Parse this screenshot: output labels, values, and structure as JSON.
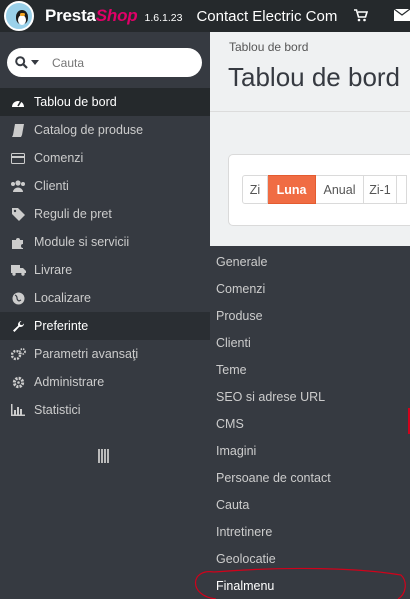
{
  "header": {
    "brand_main": "Presta",
    "brand_shop": "Shop",
    "version": "1.6.1.23",
    "shop_name": "Contact Electric Com",
    "icons": [
      "cart-icon",
      "envelope-icon"
    ]
  },
  "search": {
    "placeholder": "Cauta"
  },
  "sidebar": {
    "items": [
      {
        "label": "Tablou de bord",
        "icon": "dashboard-icon",
        "state": "active"
      },
      {
        "label": "Catalog de produse",
        "icon": "book-icon"
      },
      {
        "label": "Comenzi",
        "icon": "credit-card-icon"
      },
      {
        "label": "Clienti",
        "icon": "users-icon"
      },
      {
        "label": "Reguli de pret",
        "icon": "tag-icon"
      },
      {
        "label": "Module si servicii",
        "icon": "puzzle-icon"
      },
      {
        "label": "Livrare",
        "icon": "truck-icon"
      },
      {
        "label": "Localizare",
        "icon": "globe-icon"
      },
      {
        "label": "Preferinte",
        "icon": "wrench-icon",
        "state": "hover"
      },
      {
        "label": "Parametri avansaţi",
        "icon": "cogs-icon"
      },
      {
        "label": "Administrare",
        "icon": "gear-icon"
      },
      {
        "label": "Statistici",
        "icon": "bar-chart-icon"
      }
    ]
  },
  "content": {
    "breadcrumb": "Tablou de bord",
    "title": "Tablou de bord",
    "period_buttons": [
      "Zi",
      "Luna",
      "Anual",
      "Zi-1"
    ],
    "selected_period": "Luna"
  },
  "submenu": {
    "items": [
      "Generale",
      "Comenzi",
      "Produse",
      "Clienti",
      "Teme",
      "SEO si adrese URL",
      "CMS",
      "Imagini",
      "Persoane de contact",
      "Cauta",
      "Intretinere",
      "Geolocatie",
      "Finalmenu"
    ]
  },
  "colors": {
    "header_bg": "#25292c",
    "sidebar_bg": "#363a41",
    "brand_pink": "#df0067",
    "accent_orange": "#f06c43",
    "annotation_red": "#d0021b"
  }
}
